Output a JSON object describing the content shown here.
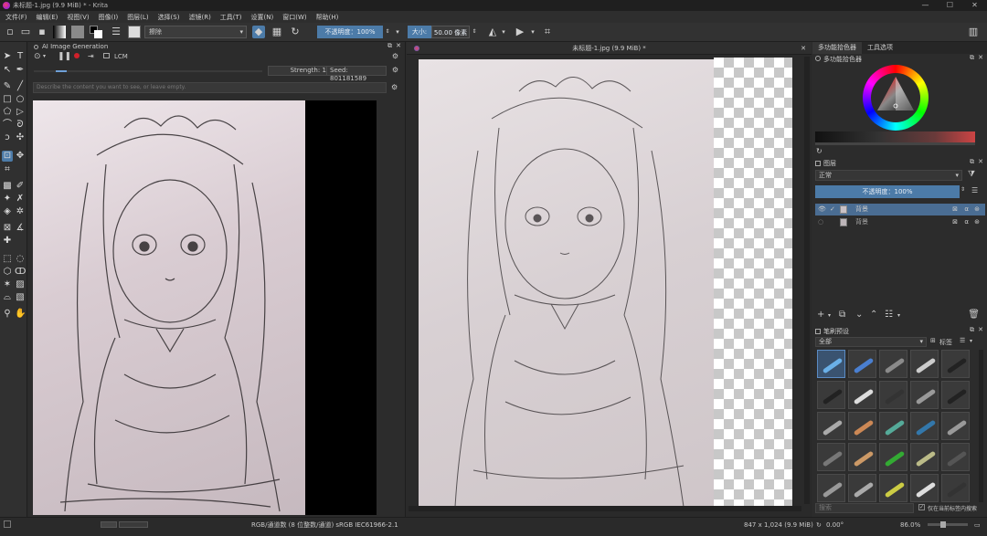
{
  "window": {
    "title": "未标题-1.jpg (9.9 MiB) * - Krita",
    "controls": [
      "—",
      "☐",
      "✕"
    ]
  },
  "menu": [
    "文件(F)",
    "编辑(E)",
    "视图(V)",
    "图像(I)",
    "图层(L)",
    "选择(S)",
    "滤镜(R)",
    "工具(T)",
    "设置(N)",
    "窗口(W)",
    "帮助(H)"
  ],
  "toolbar": {
    "blend_mode": "擦除",
    "opacity": "不透明度：100%",
    "size_label": "大小:",
    "size_value": "50.00 像素"
  },
  "ai_panel": {
    "title": "AI Image Generation",
    "model": "LCM",
    "strength": "Strength: 10%",
    "seed": "Seed: 801181589",
    "prompt_placeholder": "Describe the content you want to see, or leave empty."
  },
  "canvas": {
    "tab_title": "未标题-1.jpg (9.9 MiB) *"
  },
  "right_panel": {
    "tabs": [
      "多功能拾色器",
      "工具选项"
    ],
    "color_docker_title": "多功能拾色器",
    "layers_title": "图层",
    "blend_mode": "正常",
    "opacity": "不透明度：100%",
    "layers": [
      {
        "name": "背景",
        "selected": true
      },
      {
        "name": "背景",
        "selected": false
      }
    ],
    "brush_presets_title": "笔刷预设",
    "brush_tag": "全部",
    "brush_tag_label": "标签",
    "search_placeholder": "搜索",
    "search_in_tag": "仅在当前标签内搜索"
  },
  "statusbar": {
    "color_info": "RGB/通道数 (8 位整数/通道)  sRGB IEC61966-2.1",
    "dimensions": "847 x 1,024 (9.9 MiB)",
    "rotation": "0.00°",
    "zoom": "86.0%"
  },
  "colors": {
    "accent": "#4c7ba8",
    "bg": "#2b2b2b",
    "panel": "#2c2c2c"
  }
}
